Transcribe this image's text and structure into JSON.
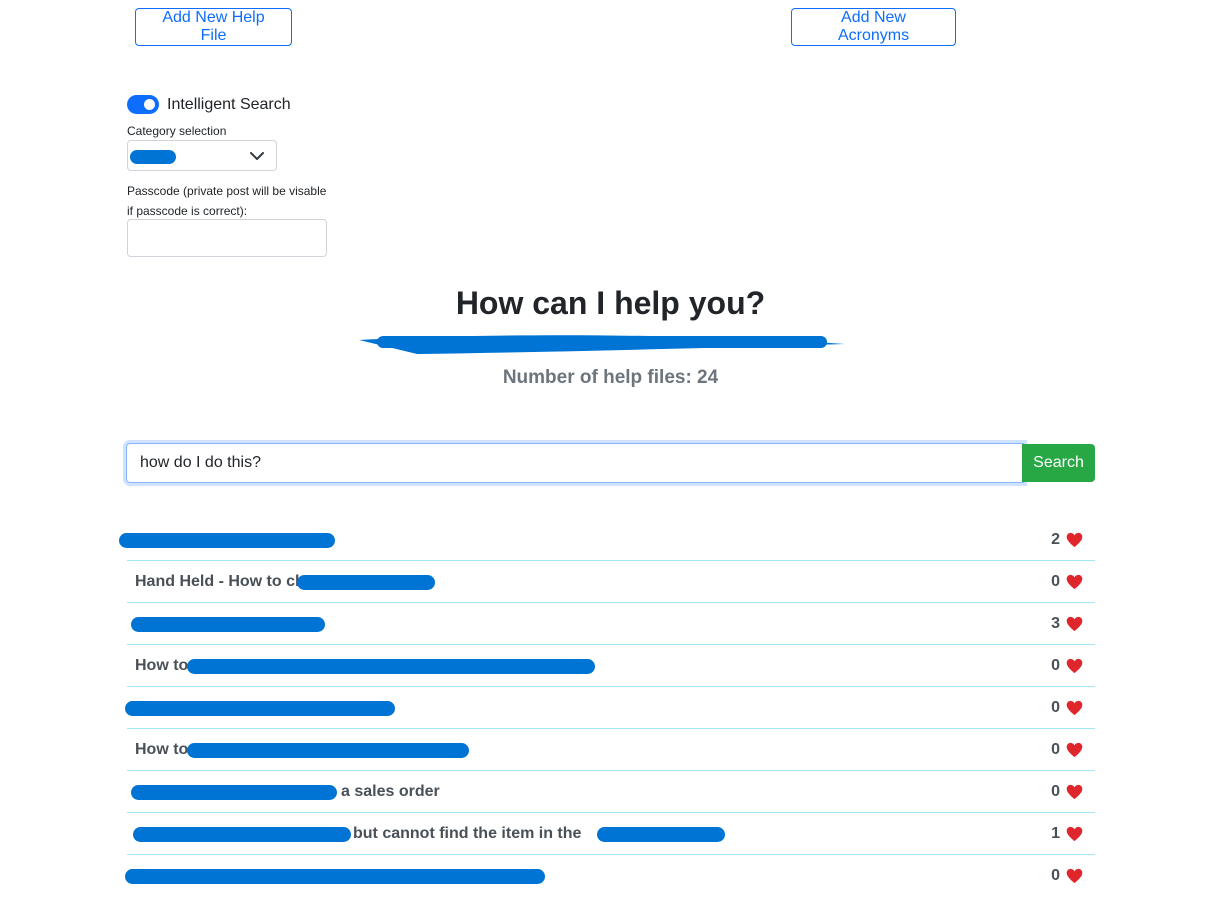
{
  "buttons": {
    "add_help_file": "Add New Help File",
    "add_acronyms": "Add New Acronyms"
  },
  "search_options": {
    "intelligent_search_label": "Intelligent Search",
    "intelligent_search_on": true,
    "category_label": "Category selection",
    "passcode_label": "Passcode (private post will be visable if passcode is correct):",
    "passcode_value": ""
  },
  "hero": {
    "title": "How can I help you?",
    "count_text": "Number of help files: 24"
  },
  "search": {
    "value": "how do I do this?",
    "button_label": "Search"
  },
  "results": [
    {
      "likes": "2"
    },
    {
      "title_visible": "Hand Held - How to chang",
      "likes": "0"
    },
    {
      "likes": "3"
    },
    {
      "title_visible": "How to",
      "likes": "0"
    },
    {
      "likes": "0"
    },
    {
      "title_visible": "How to",
      "likes": "0"
    },
    {
      "title_visible": "a sales order",
      "likes": "0"
    },
    {
      "title_visible": "but cannot find the item in the",
      "likes": "1"
    },
    {
      "likes": "0"
    }
  ],
  "colors": {
    "primary": "#0d6efd",
    "success": "#28a745",
    "heart": "#e0262d",
    "row_border": "#a6e5f5"
  }
}
